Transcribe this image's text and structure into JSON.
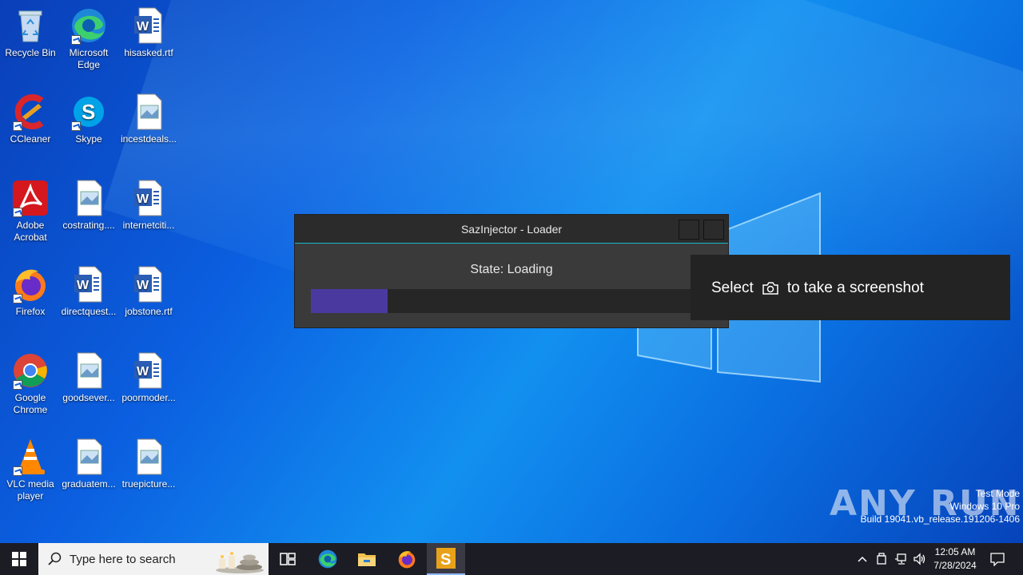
{
  "desktop": {
    "icons": [
      {
        "label": "Recycle Bin"
      },
      {
        "label": "Microsoft Edge"
      },
      {
        "label": "hisasked.rtf"
      },
      {
        "label": "CCleaner"
      },
      {
        "label": "Skype"
      },
      {
        "label": "incestdeals..."
      },
      {
        "label": "Adobe Acrobat"
      },
      {
        "label": "costrating...."
      },
      {
        "label": "internetciti..."
      },
      {
        "label": "Firefox"
      },
      {
        "label": "directquest..."
      },
      {
        "label": "jobstone.rtf"
      },
      {
        "label": "Google Chrome"
      },
      {
        "label": "goodsever..."
      },
      {
        "label": "poormoder..."
      },
      {
        "label": "VLC media player"
      },
      {
        "label": "graduatem..."
      },
      {
        "label": "truepicture..."
      }
    ]
  },
  "loader_window": {
    "title": "SazInjector - Loader",
    "state_text": "State: Loading",
    "progress": 0.19,
    "accent_color": "#16b9c8",
    "progress_color": "#4a3aa0"
  },
  "snip_toast": {
    "text_before": "Select",
    "icon": "camera-icon",
    "text_after": "to take a screenshot"
  },
  "watermark": {
    "brand": "ANY RUN",
    "line1": "Test Mode",
    "line2": "Windows 10 Pro",
    "line3": "Build 19041.vb_release.191206-1406"
  },
  "taskbar": {
    "search_placeholder": "Type here to search",
    "apps": [
      "task-view-icon",
      "edge-icon",
      "file-explorer-icon",
      "firefox-icon",
      "sazinjector-icon"
    ],
    "clock_time": "12:05 AM",
    "clock_date": "7/28/2024"
  }
}
